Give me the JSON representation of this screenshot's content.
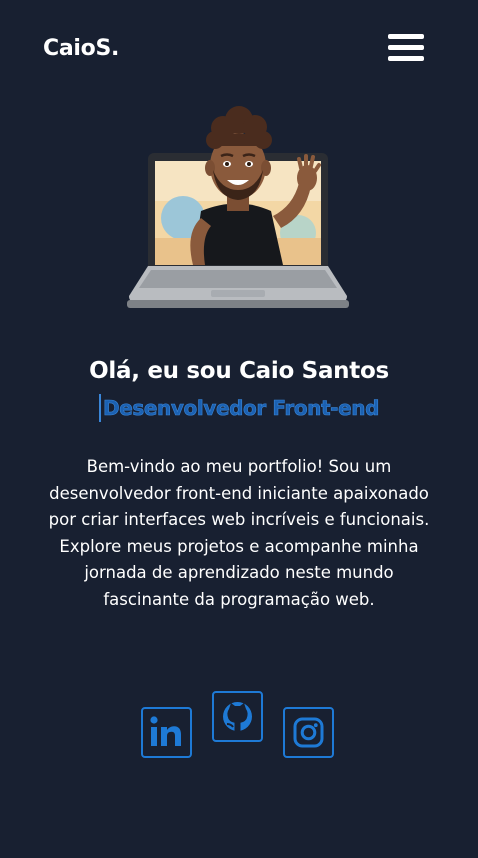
{
  "header": {
    "logo": "CaioS.",
    "menu_icon": "hamburger-menu-icon"
  },
  "hero": {
    "avatar_icon": "memoji-laptop-illustration",
    "title": "Olá, eu sou Caio Santos",
    "subtitle": "Desenvolvedor Front-end",
    "description": "Bem-vindo ao meu portfolio! Sou um desenvolvedor front-end iniciante apaixonado por criar interfaces web incríveis e funcionais. Explore meus projetos e acompanhe minha jornada de aprendizado neste mundo fascinante da programação web."
  },
  "social": [
    {
      "icon": "linkedin-icon"
    },
    {
      "icon": "github-icon"
    },
    {
      "icon": "instagram-icon"
    }
  ],
  "colors": {
    "background": "#182031",
    "accent": "#1e7ad6",
    "text": "#ffffff"
  }
}
